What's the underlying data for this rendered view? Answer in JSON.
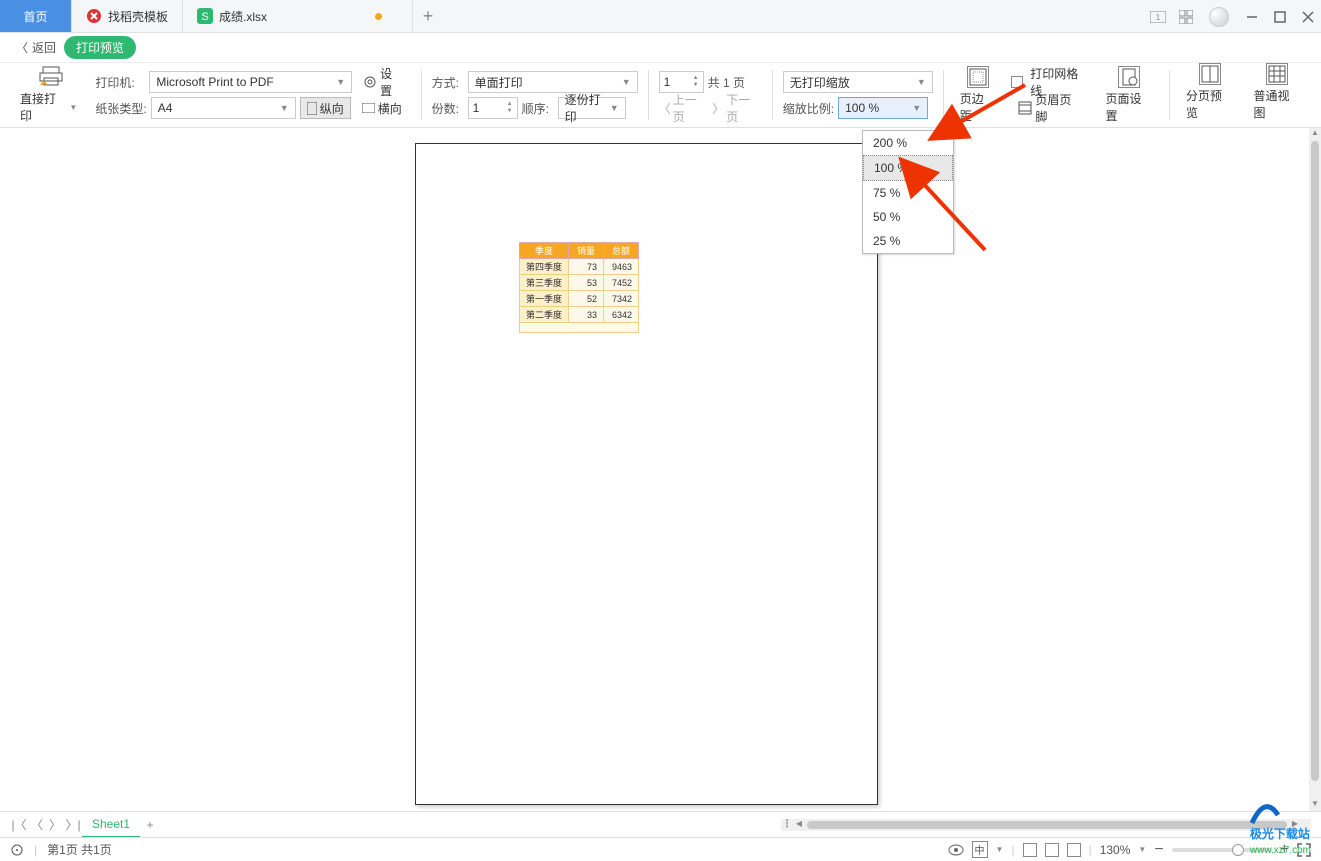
{
  "tabs": {
    "home": "首页",
    "template_tab": "找稻壳模板",
    "file_tab": "成绩.xlsx"
  },
  "subheader": {
    "back": "返回",
    "title": "打印预览"
  },
  "ribbon": {
    "direct_print": "直接打印",
    "printer_label": "打印机:",
    "printer_value": "Microsoft Print to PDF",
    "settings": "设置",
    "paper_label": "纸张类型:",
    "paper_value": "A4",
    "portrait": "纵向",
    "landscape": "横向",
    "mode_label": "方式:",
    "mode_value": "单面打印",
    "copies_label": "份数:",
    "copies_value": "1",
    "order_label": "顺序:",
    "order_value": "逐份打印",
    "page_spin": "1",
    "page_total": "共 1 页",
    "prev_page": "上一页",
    "next_page": "下一页",
    "zoom_mode_value": "无打印缩放",
    "zoom_ratio_label": "缩放比例:",
    "zoom_ratio_value": "100 %",
    "margins": "页边距",
    "header_footer": "页眉页脚",
    "grid_lines": "打印网格线",
    "page_setup": "页面设置",
    "page_break_preview": "分页预览",
    "normal_view": "普通视图"
  },
  "zoom_options": [
    "200 %",
    "100 %",
    "75 %",
    "50 %",
    "25 %"
  ],
  "zoom_selected": "100 %",
  "sheet": {
    "headers": [
      "季度",
      "销量",
      "总额"
    ],
    "rows": [
      {
        "q": "第四季度",
        "a": "73",
        "b": "9463"
      },
      {
        "q": "第三季度",
        "a": "53",
        "b": "7452"
      },
      {
        "q": "第一季度",
        "a": "52",
        "b": "7342"
      },
      {
        "q": "第二季度",
        "a": "33",
        "b": "6342"
      }
    ]
  },
  "sheetnav": {
    "sheet1": "Sheet1"
  },
  "statusbar": {
    "pageinfo": "第1页 共1页",
    "zoom": "130%"
  },
  "watermark": {
    "line1": "极光下载站",
    "line2": "www.xz7.com"
  }
}
